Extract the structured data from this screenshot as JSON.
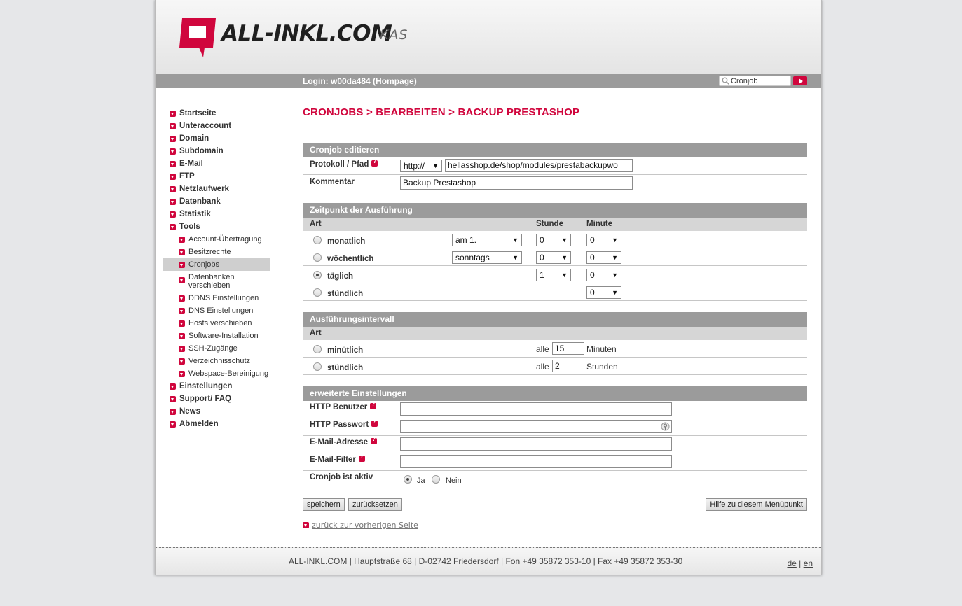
{
  "header": {
    "logo_text": "ALL-INKL.COM",
    "logo_sub": "KAS",
    "login": "Login: w00da484 (Hompage)",
    "search_value": "Cronjob"
  },
  "sidebar": {
    "items": [
      {
        "label": "Startseite"
      },
      {
        "label": "Unteraccount"
      },
      {
        "label": "Domain"
      },
      {
        "label": "Subdomain"
      },
      {
        "label": "E-Mail"
      },
      {
        "label": "FTP"
      },
      {
        "label": "Netzlaufwerk"
      },
      {
        "label": "Datenbank"
      },
      {
        "label": "Statistik"
      },
      {
        "label": "Tools"
      },
      {
        "label": "Account-Übertragung"
      },
      {
        "label": "Besitzrechte"
      },
      {
        "label": "Cronjobs"
      },
      {
        "label_line1": "Datenbanken",
        "label_line2": "verschieben"
      },
      {
        "label": "DDNS Einstellungen"
      },
      {
        "label": "DNS Einstellungen"
      },
      {
        "label": "Hosts verschieben"
      },
      {
        "label": "Software-Installation"
      },
      {
        "label": "SSH-Zugänge"
      },
      {
        "label": "Verzeichnisschutz"
      },
      {
        "label": "Webspace-Bereinigung"
      },
      {
        "label": "Einstellungen"
      },
      {
        "label": "Support/ FAQ"
      },
      {
        "label": "News"
      },
      {
        "label": "Abmelden"
      }
    ]
  },
  "main": {
    "title": "CRONJOBS > BEARBEITEN > BACKUP PRESTASHOP",
    "edit_section": {
      "heading": "Cronjob editieren",
      "protocol_label": "Protokoll / Pfad",
      "protocol_value": "http://",
      "path_value": "hellasshop.de/shop/modules/prestabackupwo",
      "comment_label": "Kommentar",
      "comment_value": "Backup Prestashop"
    },
    "time_section": {
      "heading": "Zeitpunkt der Ausführung",
      "col_art": "Art",
      "col_hour": "Stunde",
      "col_minute": "Minute",
      "rows": [
        {
          "label": "monatlich",
          "day": "am 1.",
          "hour": "0",
          "minute": "0"
        },
        {
          "label": "wöchentlich",
          "day": "sonntags",
          "hour": "0",
          "minute": "0"
        },
        {
          "label": "täglich",
          "hour": "1",
          "minute": "0"
        },
        {
          "label": "stündlich",
          "minute": "0"
        }
      ]
    },
    "interval_section": {
      "heading": "Ausführungsintervall",
      "col_art": "Art",
      "rows": [
        {
          "label": "minütlich",
          "prefix": "alle",
          "value": "15",
          "unit": "Minuten"
        },
        {
          "label": "stündlich",
          "prefix": "alle",
          "value": "2",
          "unit": "Stunden"
        }
      ]
    },
    "advanced_section": {
      "heading": "erweiterte Einstellungen",
      "http_user_label": "HTTP Benutzer",
      "http_pass_label": "HTTP Passwort",
      "email_label": "E-Mail-Adresse",
      "email_filter_label": "E-Mail-Filter",
      "active_label": "Cronjob ist aktiv",
      "yes": "Ja",
      "no": "Nein"
    },
    "buttons": {
      "save": "speichern",
      "reset": "zurücksetzen",
      "help": "Hilfe zu diesem Menüpunkt"
    },
    "back_link": "zurück zur vorherigen Seite"
  },
  "footer": {
    "address": "ALL-INKL.COM | Hauptstraße 68 | D-02742 Friedersdorf | Fon +49 35872 353-10 | Fax +49 35872 353-30",
    "lang_de": "de",
    "lang_sep": "|",
    "lang_en": "en"
  },
  "colors": {
    "accent": "#d0063d",
    "bar": "#9b9b9b"
  }
}
